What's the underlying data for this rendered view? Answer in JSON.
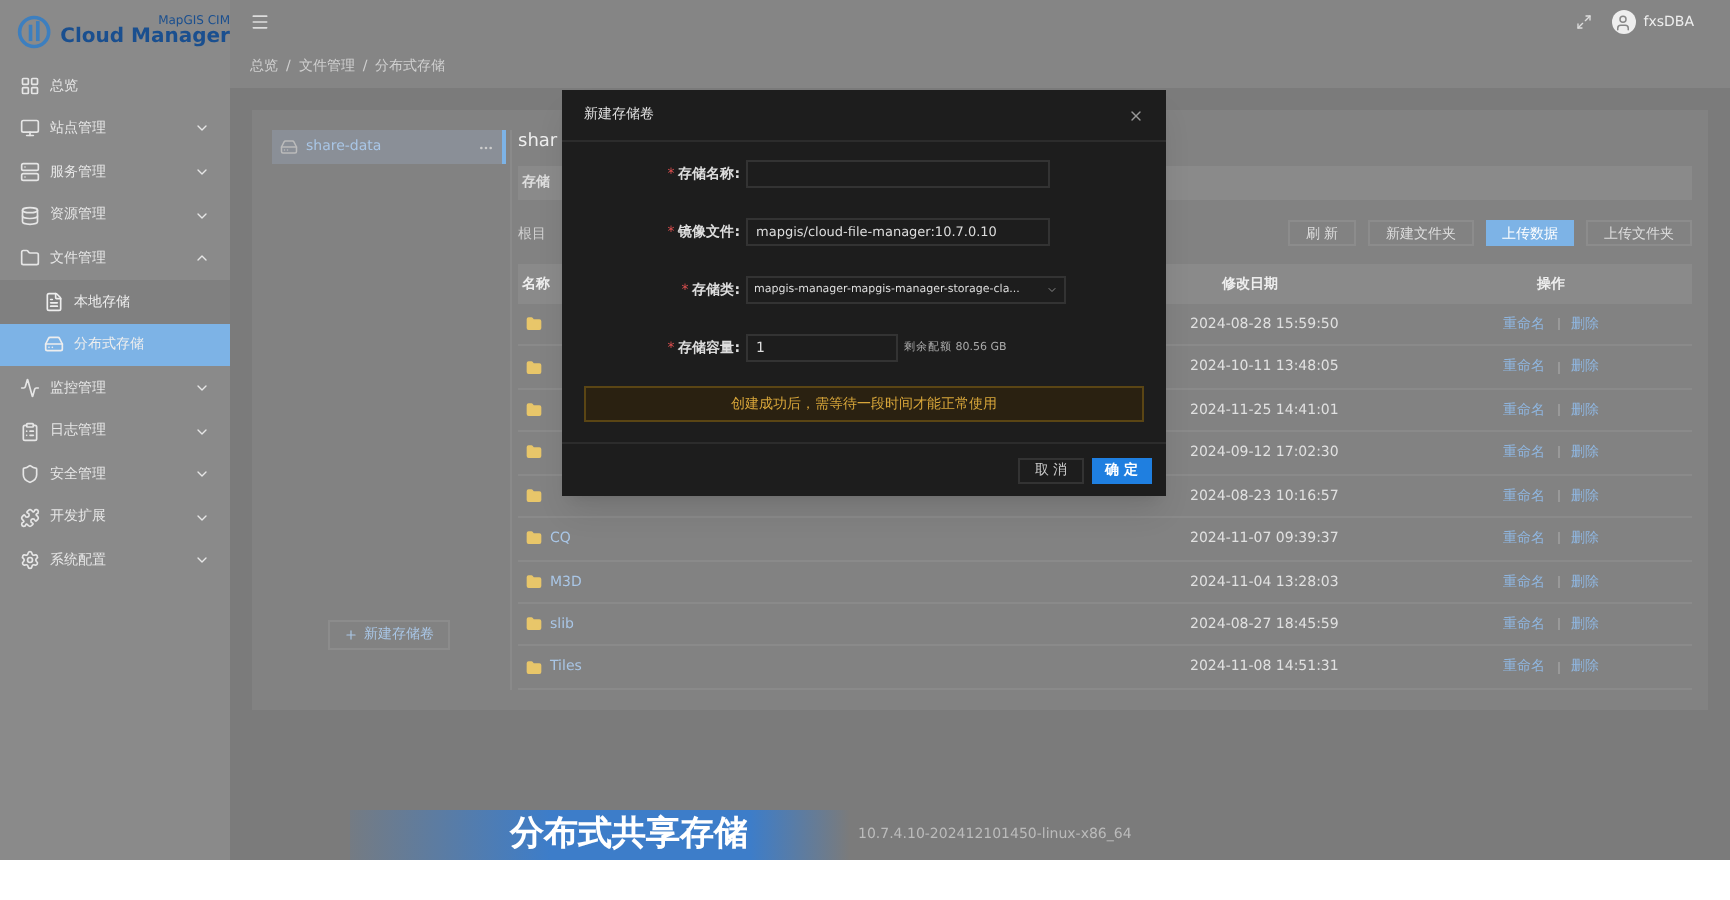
{
  "logo": {
    "line1": "MapGIS CIM",
    "line2": "Cloud Manager"
  },
  "header": {
    "user": "fxsDBA"
  },
  "breadcrumb": [
    "总览",
    "文件管理",
    "分布式存储"
  ],
  "breadcrumb_separator": "/",
  "sidebar": {
    "items": [
      {
        "label": "总览",
        "kind": "link"
      },
      {
        "label": "站点管理",
        "kind": "group",
        "expanded": false
      },
      {
        "label": "服务管理",
        "kind": "group",
        "expanded": false
      },
      {
        "label": "资源管理",
        "kind": "group",
        "expanded": false
      },
      {
        "label": "文件管理",
        "kind": "group",
        "expanded": true,
        "children": [
          {
            "label": "本地存储",
            "selected": false
          },
          {
            "label": "分布式存储",
            "selected": true
          }
        ]
      },
      {
        "label": "监控管理",
        "kind": "group",
        "expanded": false
      },
      {
        "label": "日志管理",
        "kind": "group",
        "expanded": false
      },
      {
        "label": "安全管理",
        "kind": "group",
        "expanded": false
      },
      {
        "label": "开发扩展",
        "kind": "group",
        "expanded": false
      },
      {
        "label": "系统配置",
        "kind": "group",
        "expanded": false
      }
    ]
  },
  "storage_list": {
    "items": [
      {
        "name": "share-data",
        "selected": true
      }
    ],
    "add_button": "新建存储卷"
  },
  "content": {
    "title": "shar",
    "tab": "存储",
    "path": "根目",
    "buttons": [
      {
        "label": "刷 新",
        "primary": false
      },
      {
        "label": "新建文件夹",
        "primary": false
      },
      {
        "label": "上传数据",
        "primary": true
      },
      {
        "label": "上传文件夹",
        "primary": false
      }
    ],
    "columns": [
      "名称",
      "修改日期",
      "操作"
    ],
    "rows": [
      {
        "date": "2024-08-28 15:59:50",
        "actions": [
          "重命名",
          "删除"
        ]
      },
      {
        "date": "2024-10-11 13:48:05",
        "actions": [
          "重命名",
          "删除"
        ]
      },
      {
        "date": "2024-11-25 14:41:01",
        "actions": [
          "重命名",
          "删除"
        ]
      },
      {
        "date": "2024-09-12 17:02:30",
        "actions": [
          "重命名",
          "删除"
        ]
      },
      {
        "date": "2024-08-23 10:16:57",
        "actions": [
          "重命名",
          "删除"
        ]
      },
      {
        "name": "CQ",
        "date": "2024-11-07 09:39:37",
        "actions": [
          "重命名",
          "删除"
        ]
      },
      {
        "name": "M3D",
        "date": "2024-11-04 13:28:03",
        "actions": [
          "重命名",
          "删除"
        ]
      },
      {
        "name": "slib",
        "date": "2024-08-27 18:45:59",
        "actions": [
          "重命名",
          "删除"
        ]
      },
      {
        "name": "Tiles",
        "date": "2024-11-08 14:51:31",
        "actions": [
          "重命名",
          "删除"
        ]
      }
    ]
  },
  "modal": {
    "title": "新建存储卷",
    "required_mark": "*",
    "fields": [
      {
        "label": "存储名称:",
        "required": true,
        "kind": "input"
      },
      {
        "label": "镜像文件:",
        "required": true,
        "kind": "input",
        "value": "mapgis/cloud-file-manager:10.7.0.10"
      },
      {
        "label": "存储类:",
        "required": true,
        "kind": "select",
        "value": "mapgis-manager-mapgis-manager-storage-cla..."
      },
      {
        "label": "存储容量:",
        "required": true,
        "kind": "number",
        "value": "1",
        "hint": "剩余配额 80.56 GB"
      }
    ],
    "alert": "创建成功后，需等待一段时间才能正常使用",
    "buttons": [
      {
        "label": "取 消",
        "primary": false
      },
      {
        "label": "确 定",
        "primary": true
      }
    ]
  },
  "caption": "分布式共享存储",
  "version": "10.7.4.10-202412101450-linux-x86_64"
}
